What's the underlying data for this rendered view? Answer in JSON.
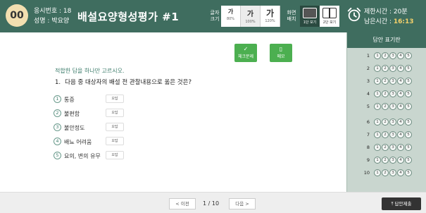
{
  "header": {
    "seat_number": "00",
    "examinee_number_label": "응시번호 : 18",
    "examinee_name_label": "성명 : 박요양",
    "exam_title": "배설요양형성평가 #1",
    "font_size_label_line1": "글자",
    "font_size_label_line2": "크기",
    "font_sizes": [
      {
        "glyph": "가",
        "percent": "80%"
      },
      {
        "glyph": "가",
        "percent": "100%"
      },
      {
        "glyph": "가",
        "percent": "120%"
      }
    ],
    "layout_label_line1": "화면",
    "layout_label_line2": "배치",
    "layouts": [
      {
        "label": "1단 보기"
      },
      {
        "label": "2단 보기"
      }
    ],
    "time_limit_label": "제한시간 : 20분",
    "time_remaining_label": "남은시간 : ",
    "time_remaining_value": "16:13"
  },
  "actions": {
    "check_label": "체크문제",
    "check_icon": "✓",
    "memo_label": "메모",
    "memo_icon": "▯"
  },
  "question": {
    "instruction": "적합한 답을 하나만 고르시오.",
    "number": "1.",
    "text": "다음 중 대상자의 배설 전 관찰내용으로 옳은 것은?",
    "options": [
      {
        "num": "1",
        "text": "통증",
        "wrong_label": "오답"
      },
      {
        "num": "2",
        "text": "불편함",
        "wrong_label": "오답"
      },
      {
        "num": "3",
        "text": "불안정도",
        "wrong_label": "오답"
      },
      {
        "num": "4",
        "text": "배뇨 어려움",
        "wrong_label": "오답"
      },
      {
        "num": "5",
        "text": "요의, 변의 유무",
        "wrong_label": "오답"
      }
    ]
  },
  "answer_panel": {
    "title": "답안 표기란",
    "rows": [
      "1",
      "2",
      "3",
      "4",
      "5",
      "6",
      "7",
      "8",
      "9",
      "10"
    ],
    "choices": [
      "1",
      "2",
      "3",
      "4",
      "5"
    ]
  },
  "footer": {
    "prev_label": "< 이전",
    "page_indicator": "1 / 10",
    "next_label": "다음 >",
    "submit_label": "⤒ 답안제출"
  }
}
